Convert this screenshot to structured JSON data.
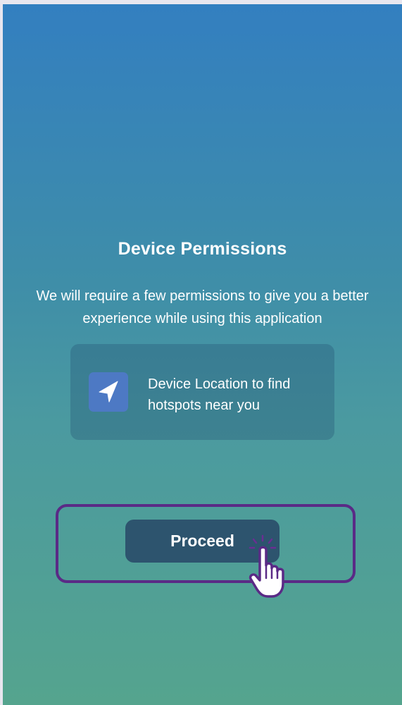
{
  "permissions_screen": {
    "title": "Device Permissions",
    "description": "We will require a few permissions to give you a better experience while using this application",
    "items": [
      {
        "icon": "navigation-arrow-icon",
        "label": "Device Location to find hotspots near you"
      }
    ],
    "proceed_label": "Proceed"
  },
  "colors": {
    "gradient_top": "#337fc0",
    "gradient_bottom": "#55a48e",
    "card_bg": "#2e6479",
    "icon_bg": "#4d79c4",
    "button_bg": "#2d546e",
    "highlight_border": "#5a2a86"
  }
}
